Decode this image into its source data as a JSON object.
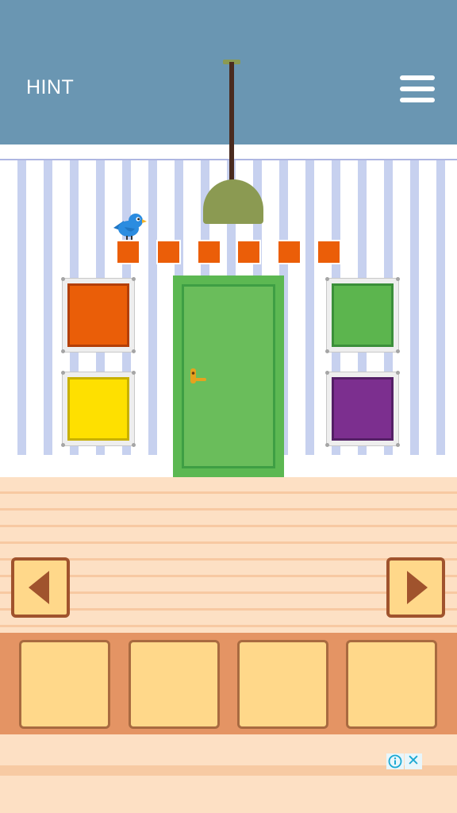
{
  "header": {
    "hint_label": "HINT",
    "menu_icon": "hamburger-menu-icon"
  },
  "scene": {
    "code_squares": {
      "count": 6,
      "color": "#eb5e08"
    },
    "frames": [
      {
        "name": "orange",
        "color": "#ea5e08",
        "border": "#b33f07"
      },
      {
        "name": "green",
        "color": "#5cb54e",
        "border": "#3b8f3a"
      },
      {
        "name": "yellow",
        "color": "#fee000",
        "border": "#c8b000"
      },
      {
        "name": "purple",
        "color": "#7c2f8f",
        "border": "#541f66"
      }
    ],
    "door": {
      "color": "#5cb852"
    },
    "bird": {
      "color": "#2b8ce0"
    },
    "lamp": {
      "shade_color": "#8b9a52"
    }
  },
  "navigation": {
    "left_icon": "left-arrow-icon",
    "right_icon": "right-arrow-icon"
  },
  "inventory": {
    "slots": [
      "",
      "",
      "",
      ""
    ]
  },
  "ad": {
    "info_icon": "info-icon",
    "close_icon": "close-icon",
    "close_glyph": "✕"
  },
  "colors": {
    "header_bg": "#6a96b2",
    "inventory_bg": "#e49464",
    "slot_bg": "#ffd88a",
    "arrow_btn_bg": "#ffd88a",
    "arrow_color": "#a0532d"
  }
}
